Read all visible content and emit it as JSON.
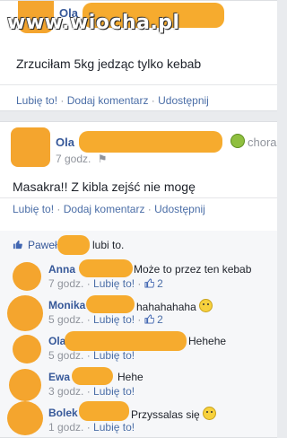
{
  "watermark": "www.wiocha.pl",
  "post1": {
    "author_prefix": "Ola",
    "text": "Zrzuciłam 5kg jedząc tylko kebab",
    "actions": {
      "like": "Lubię to!",
      "comment": "Dodaj komentarz",
      "share": "Udostępnij"
    }
  },
  "post2": {
    "author_prefix": "Ola",
    "status_suffix": "chora",
    "time": "7 godz.",
    "text": "Masakra!! Z kibla zejść nie mogę",
    "actions": {
      "like": "Lubię to!",
      "comment": "Dodaj komentarz",
      "share": "Udostępnij"
    },
    "likes": {
      "name_prefix": "Paweł",
      "suffix": "lubi to."
    },
    "comments": [
      {
        "name_prefix": "Anna",
        "text": "Może to przez ten kebab",
        "time": "7 godz.",
        "like_label": "Lubię to!",
        "like_count": "2"
      },
      {
        "name_prefix": "Monika",
        "text": "hahahahaha",
        "time": "5 godz.",
        "like_label": "Lubię to!",
        "like_count": "2"
      },
      {
        "name_prefix": "Ola",
        "text": "Hehehe",
        "time": "5 godz.",
        "like_label": "Lubię to!"
      },
      {
        "name_prefix": "Ewa",
        "text": "Hehe",
        "time": "3 godz.",
        "like_label": "Lubię to!"
      },
      {
        "name_prefix": "Bolek",
        "text": "Przyssalas się",
        "time": "1 godz.",
        "like_label": "Lubię to!"
      }
    ]
  },
  "colors": {
    "link": "#365899",
    "meta": "#90949c",
    "blur": "#f5a623"
  },
  "icons": [
    "sick-face-icon",
    "thumbs-up-icon",
    "smile-emoji-icon",
    "surprised-emoji-icon",
    "globe-icon"
  ]
}
